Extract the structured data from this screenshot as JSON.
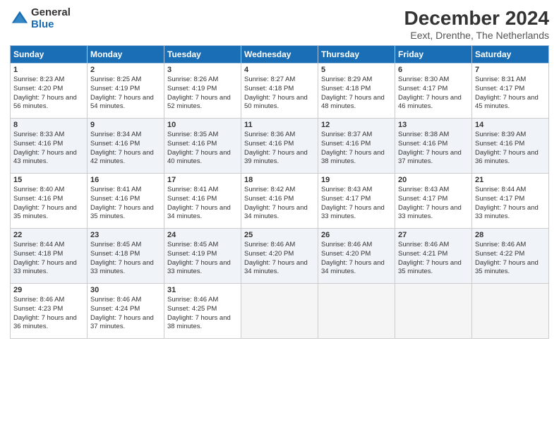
{
  "logo": {
    "general": "General",
    "blue": "Blue"
  },
  "header": {
    "month": "December 2024",
    "location": "Eext, Drenthe, The Netherlands"
  },
  "weekdays": [
    "Sunday",
    "Monday",
    "Tuesday",
    "Wednesday",
    "Thursday",
    "Friday",
    "Saturday"
  ],
  "weeks": [
    [
      {
        "day": "1",
        "sunrise": "Sunrise: 8:23 AM",
        "sunset": "Sunset: 4:20 PM",
        "daylight": "Daylight: 7 hours and 56 minutes."
      },
      {
        "day": "2",
        "sunrise": "Sunrise: 8:25 AM",
        "sunset": "Sunset: 4:19 PM",
        "daylight": "Daylight: 7 hours and 54 minutes."
      },
      {
        "day": "3",
        "sunrise": "Sunrise: 8:26 AM",
        "sunset": "Sunset: 4:19 PM",
        "daylight": "Daylight: 7 hours and 52 minutes."
      },
      {
        "day": "4",
        "sunrise": "Sunrise: 8:27 AM",
        "sunset": "Sunset: 4:18 PM",
        "daylight": "Daylight: 7 hours and 50 minutes."
      },
      {
        "day": "5",
        "sunrise": "Sunrise: 8:29 AM",
        "sunset": "Sunset: 4:18 PM",
        "daylight": "Daylight: 7 hours and 48 minutes."
      },
      {
        "day": "6",
        "sunrise": "Sunrise: 8:30 AM",
        "sunset": "Sunset: 4:17 PM",
        "daylight": "Daylight: 7 hours and 46 minutes."
      },
      {
        "day": "7",
        "sunrise": "Sunrise: 8:31 AM",
        "sunset": "Sunset: 4:17 PM",
        "daylight": "Daylight: 7 hours and 45 minutes."
      }
    ],
    [
      {
        "day": "8",
        "sunrise": "Sunrise: 8:33 AM",
        "sunset": "Sunset: 4:16 PM",
        "daylight": "Daylight: 7 hours and 43 minutes."
      },
      {
        "day": "9",
        "sunrise": "Sunrise: 8:34 AM",
        "sunset": "Sunset: 4:16 PM",
        "daylight": "Daylight: 7 hours and 42 minutes."
      },
      {
        "day": "10",
        "sunrise": "Sunrise: 8:35 AM",
        "sunset": "Sunset: 4:16 PM",
        "daylight": "Daylight: 7 hours and 40 minutes."
      },
      {
        "day": "11",
        "sunrise": "Sunrise: 8:36 AM",
        "sunset": "Sunset: 4:16 PM",
        "daylight": "Daylight: 7 hours and 39 minutes."
      },
      {
        "day": "12",
        "sunrise": "Sunrise: 8:37 AM",
        "sunset": "Sunset: 4:16 PM",
        "daylight": "Daylight: 7 hours and 38 minutes."
      },
      {
        "day": "13",
        "sunrise": "Sunrise: 8:38 AM",
        "sunset": "Sunset: 4:16 PM",
        "daylight": "Daylight: 7 hours and 37 minutes."
      },
      {
        "day": "14",
        "sunrise": "Sunrise: 8:39 AM",
        "sunset": "Sunset: 4:16 PM",
        "daylight": "Daylight: 7 hours and 36 minutes."
      }
    ],
    [
      {
        "day": "15",
        "sunrise": "Sunrise: 8:40 AM",
        "sunset": "Sunset: 4:16 PM",
        "daylight": "Daylight: 7 hours and 35 minutes."
      },
      {
        "day": "16",
        "sunrise": "Sunrise: 8:41 AM",
        "sunset": "Sunset: 4:16 PM",
        "daylight": "Daylight: 7 hours and 35 minutes."
      },
      {
        "day": "17",
        "sunrise": "Sunrise: 8:41 AM",
        "sunset": "Sunset: 4:16 PM",
        "daylight": "Daylight: 7 hours and 34 minutes."
      },
      {
        "day": "18",
        "sunrise": "Sunrise: 8:42 AM",
        "sunset": "Sunset: 4:16 PM",
        "daylight": "Daylight: 7 hours and 34 minutes."
      },
      {
        "day": "19",
        "sunrise": "Sunrise: 8:43 AM",
        "sunset": "Sunset: 4:17 PM",
        "daylight": "Daylight: 7 hours and 33 minutes."
      },
      {
        "day": "20",
        "sunrise": "Sunrise: 8:43 AM",
        "sunset": "Sunset: 4:17 PM",
        "daylight": "Daylight: 7 hours and 33 minutes."
      },
      {
        "day": "21",
        "sunrise": "Sunrise: 8:44 AM",
        "sunset": "Sunset: 4:17 PM",
        "daylight": "Daylight: 7 hours and 33 minutes."
      }
    ],
    [
      {
        "day": "22",
        "sunrise": "Sunrise: 8:44 AM",
        "sunset": "Sunset: 4:18 PM",
        "daylight": "Daylight: 7 hours and 33 minutes."
      },
      {
        "day": "23",
        "sunrise": "Sunrise: 8:45 AM",
        "sunset": "Sunset: 4:18 PM",
        "daylight": "Daylight: 7 hours and 33 minutes."
      },
      {
        "day": "24",
        "sunrise": "Sunrise: 8:45 AM",
        "sunset": "Sunset: 4:19 PM",
        "daylight": "Daylight: 7 hours and 33 minutes."
      },
      {
        "day": "25",
        "sunrise": "Sunrise: 8:46 AM",
        "sunset": "Sunset: 4:20 PM",
        "daylight": "Daylight: 7 hours and 34 minutes."
      },
      {
        "day": "26",
        "sunrise": "Sunrise: 8:46 AM",
        "sunset": "Sunset: 4:20 PM",
        "daylight": "Daylight: 7 hours and 34 minutes."
      },
      {
        "day": "27",
        "sunrise": "Sunrise: 8:46 AM",
        "sunset": "Sunset: 4:21 PM",
        "daylight": "Daylight: 7 hours and 35 minutes."
      },
      {
        "day": "28",
        "sunrise": "Sunrise: 8:46 AM",
        "sunset": "Sunset: 4:22 PM",
        "daylight": "Daylight: 7 hours and 35 minutes."
      }
    ],
    [
      {
        "day": "29",
        "sunrise": "Sunrise: 8:46 AM",
        "sunset": "Sunset: 4:23 PM",
        "daylight": "Daylight: 7 hours and 36 minutes."
      },
      {
        "day": "30",
        "sunrise": "Sunrise: 8:46 AM",
        "sunset": "Sunset: 4:24 PM",
        "daylight": "Daylight: 7 hours and 37 minutes."
      },
      {
        "day": "31",
        "sunrise": "Sunrise: 8:46 AM",
        "sunset": "Sunset: 4:25 PM",
        "daylight": "Daylight: 7 hours and 38 minutes."
      },
      null,
      null,
      null,
      null
    ]
  ]
}
